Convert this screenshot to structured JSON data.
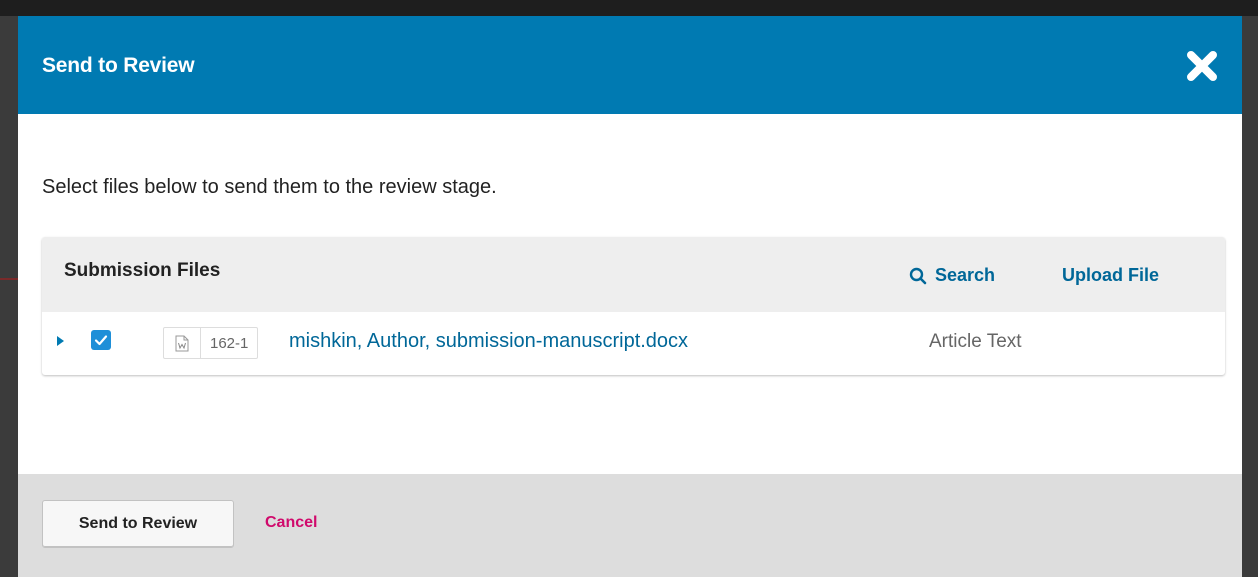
{
  "modal": {
    "title": "Send to Review",
    "close_icon": "close-icon",
    "header_color": "#007ab2"
  },
  "body": {
    "intro": "Select files below to send them to the review stage."
  },
  "files_panel": {
    "title": "Submission Files",
    "search_label": "Search",
    "search_icon": "search-icon",
    "upload_label": "Upload File",
    "link_color": "#006798",
    "rows": [
      {
        "checked": true,
        "file_icon": "word-document-icon",
        "file_id": "162-1",
        "file_name": "mishkin, Author, submission-manuscript.docx",
        "file_type": "Article Text"
      }
    ]
  },
  "footer": {
    "send_label": "Send to Review",
    "cancel_label": "Cancel",
    "cancel_color": "#d00a6c"
  }
}
